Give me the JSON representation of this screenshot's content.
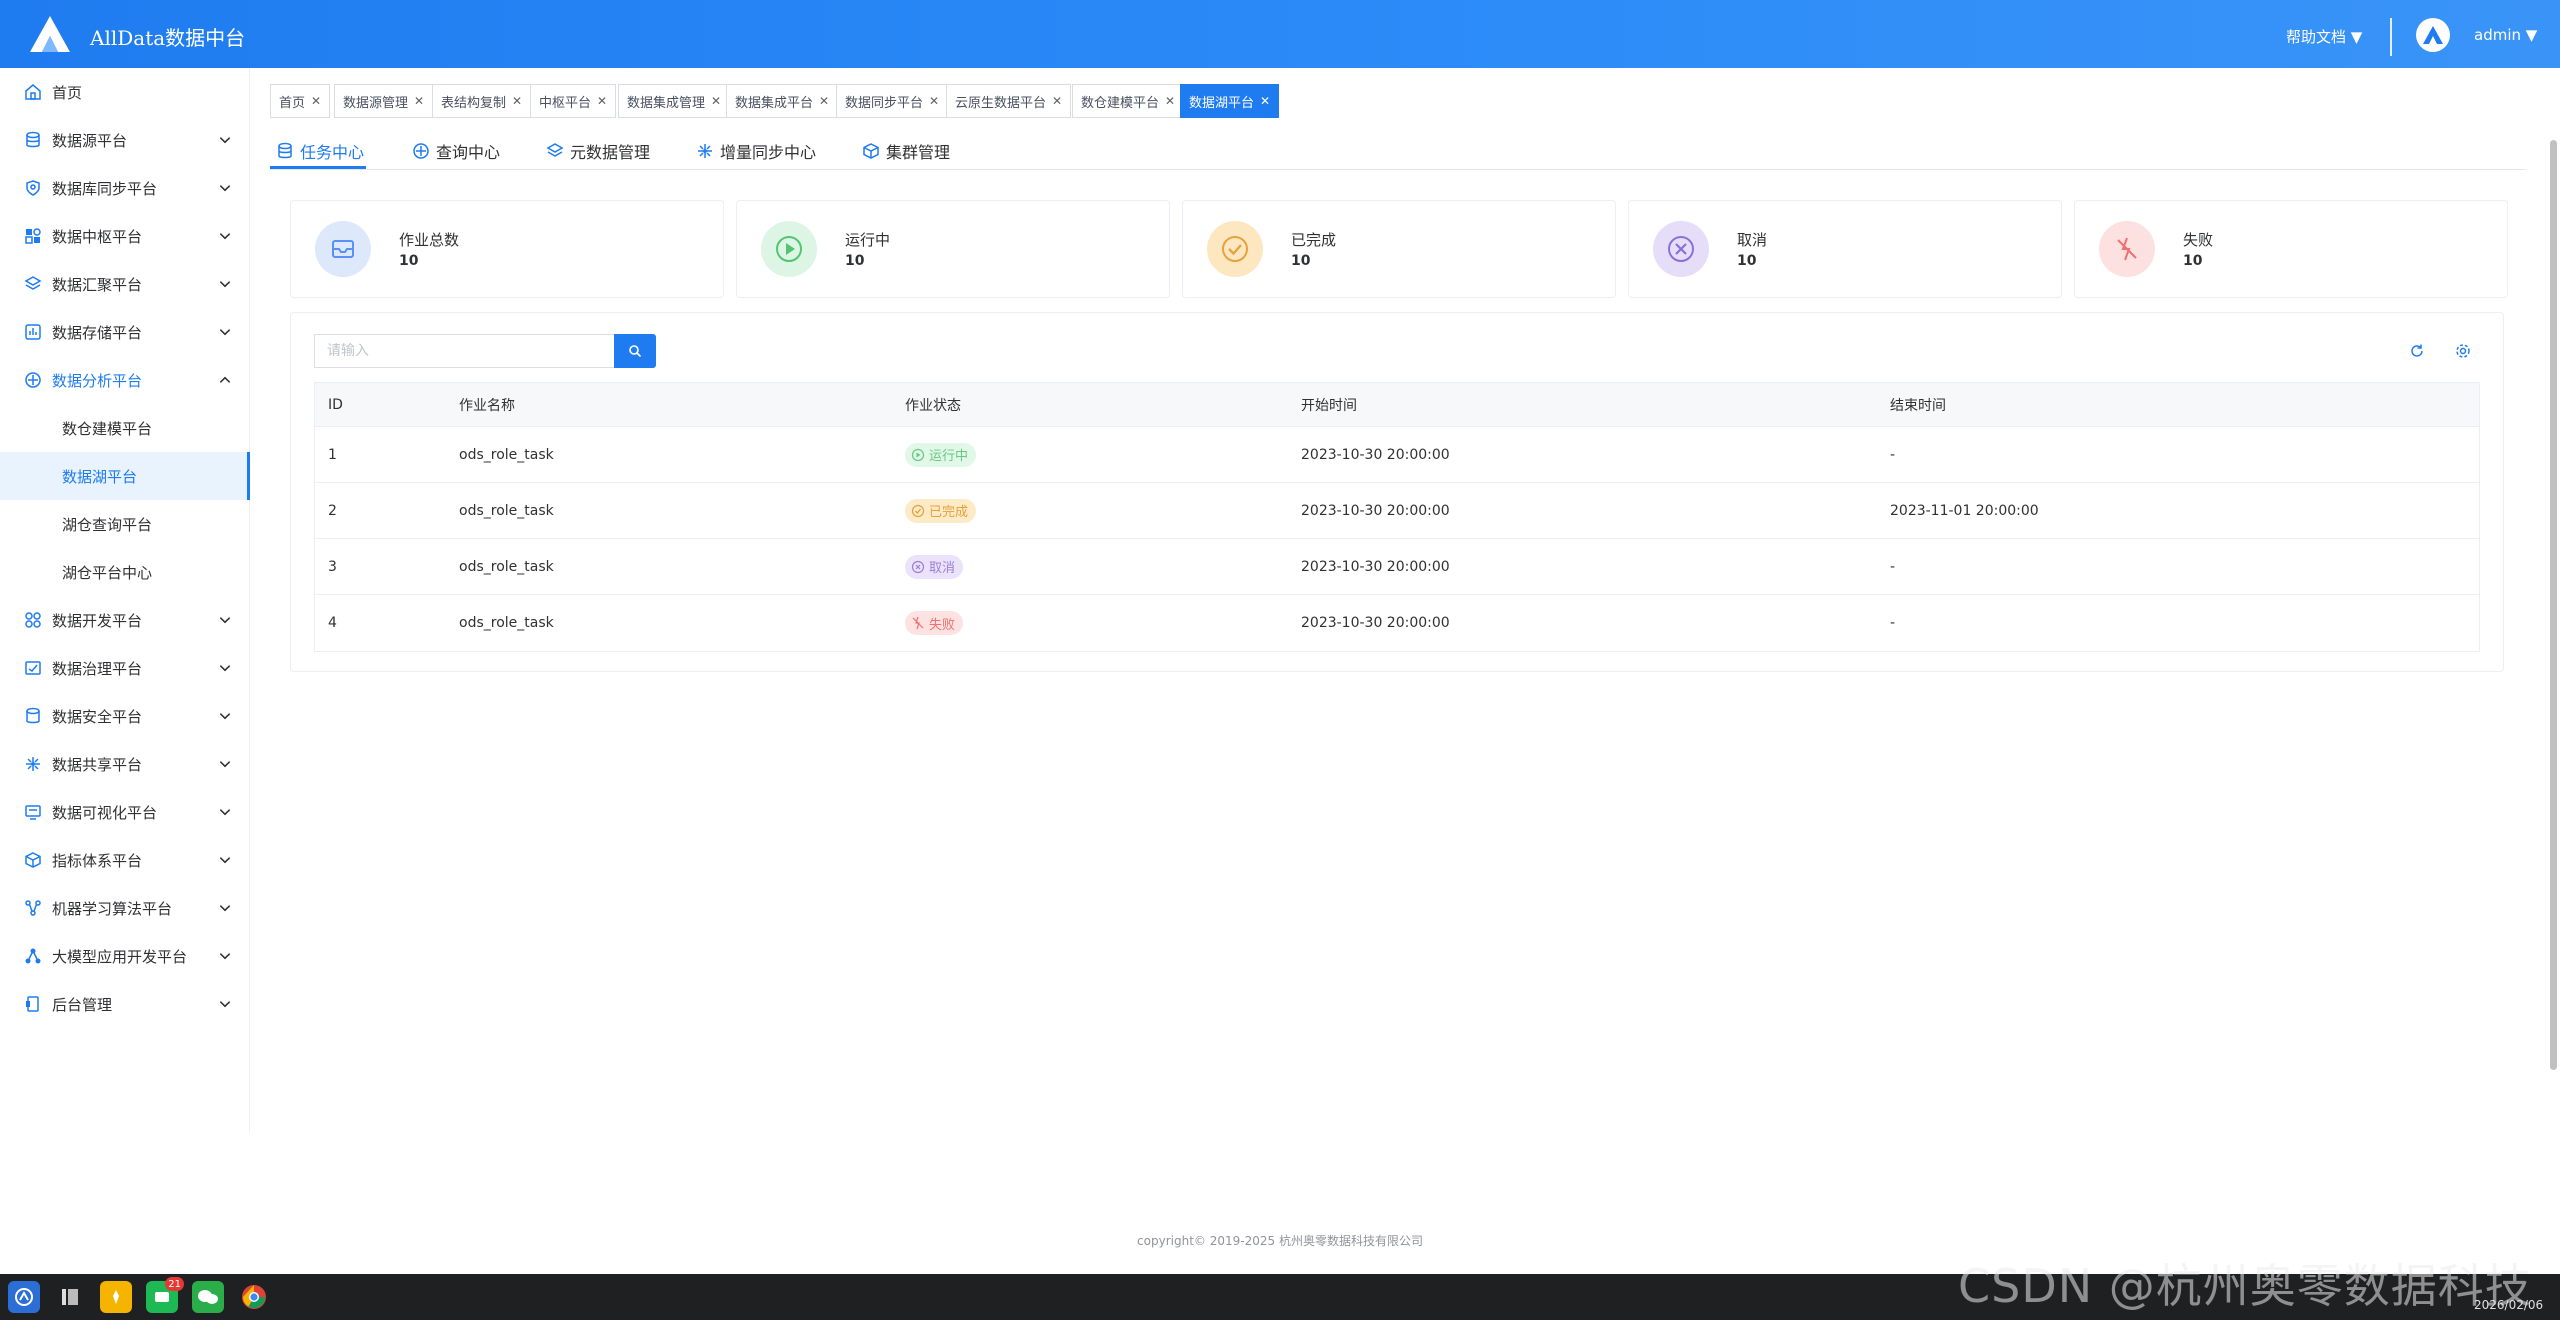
{
  "header": {
    "app_title": "AllData数据中台",
    "help_docs": "帮助文档 ▼",
    "username": "admin ▼"
  },
  "sidebar": {
    "items": [
      {
        "label": "首页",
        "icon": "home-icon",
        "has_arrow": false
      },
      {
        "label": "数据源平台",
        "icon": "database-icon",
        "has_arrow": true
      },
      {
        "label": "数据库同步平台",
        "icon": "shield-db-icon",
        "has_arrow": true
      },
      {
        "label": "数据中枢平台",
        "icon": "blocks-icon",
        "has_arrow": true
      },
      {
        "label": "数据汇聚平台",
        "icon": "layers-icon",
        "has_arrow": true
      },
      {
        "label": "数据存储平台",
        "icon": "bar-chart-icon",
        "has_arrow": true
      },
      {
        "label": "数据分析平台",
        "icon": "analysis-icon",
        "has_arrow": true,
        "expanded": true
      },
      {
        "label": "数据开发平台",
        "icon": "dev-icon",
        "has_arrow": true
      },
      {
        "label": "数据治理平台",
        "icon": "governance-icon",
        "has_arrow": true
      },
      {
        "label": "数据安全平台",
        "icon": "security-icon",
        "has_arrow": true
      },
      {
        "label": "数据共享平台",
        "icon": "share-icon",
        "has_arrow": true
      },
      {
        "label": "数据可视化平台",
        "icon": "monitor-icon",
        "has_arrow": true
      },
      {
        "label": "指标体系平台",
        "icon": "cube-icon",
        "has_arrow": true
      },
      {
        "label": "机器学习算法平台",
        "icon": "ml-icon",
        "has_arrow": true
      },
      {
        "label": "大模型应用开发平台",
        "icon": "llm-icon",
        "has_arrow": true
      },
      {
        "label": "后台管理",
        "icon": "admin-icon",
        "has_arrow": true
      }
    ],
    "sub_items": [
      {
        "label": "数仓建模平台",
        "active": false
      },
      {
        "label": "数据湖平台",
        "active": true
      },
      {
        "label": "湖仓查询平台",
        "active": false
      },
      {
        "label": "湖仓平台中心",
        "active": false
      }
    ]
  },
  "tags": [
    {
      "label": "首页"
    },
    {
      "label": "数据源管理"
    },
    {
      "label": "表结构复制"
    },
    {
      "label": "中枢平台"
    },
    {
      "label": "数据集成管理"
    },
    {
      "label": "数据集成平台"
    },
    {
      "label": "数据同步平台"
    },
    {
      "label": "云原生数据平台"
    },
    {
      "label": "数仓建模平台"
    },
    {
      "label": "数据湖平台",
      "active": true
    }
  ],
  "tabs": [
    {
      "label": "任务中心",
      "active": true
    },
    {
      "label": "查询中心"
    },
    {
      "label": "元数据管理"
    },
    {
      "label": "增量同步中心"
    },
    {
      "label": "集群管理"
    }
  ],
  "stats": [
    {
      "label": "作业总数",
      "value": "10",
      "color": "#5b8ff9",
      "bg": "#dde8fb"
    },
    {
      "label": "运行中",
      "value": "10",
      "color": "#52c472",
      "bg": "#dcf5e4"
    },
    {
      "label": "已完成",
      "value": "10",
      "color": "#e6a23c",
      "bg": "#fde7c0"
    },
    {
      "label": "取消",
      "value": "10",
      "color": "#8c6fd6",
      "bg": "#e6ddf8"
    },
    {
      "label": "失败",
      "value": "10",
      "color": "#f07070",
      "bg": "#fde0e0"
    }
  ],
  "search": {
    "placeholder": "请输入"
  },
  "table": {
    "columns": [
      "ID",
      "作业名称",
      "作业状态",
      "开始时间",
      "结束时间"
    ],
    "rows": [
      {
        "id": "1",
        "name": "ods_role_task",
        "status": "运行中",
        "status_type": "running",
        "start": "2023-10-30 20:00:00",
        "end": "-"
      },
      {
        "id": "2",
        "name": "ods_role_task",
        "status": "已完成",
        "status_type": "done",
        "start": "2023-10-30 20:00:00",
        "end": "2023-11-01 20:00:00"
      },
      {
        "id": "3",
        "name": "ods_role_task",
        "status": "取消",
        "status_type": "cancel",
        "start": "2023-10-30 20:00:00",
        "end": "-"
      },
      {
        "id": "4",
        "name": "ods_role_task",
        "status": "失败",
        "status_type": "fail",
        "start": "2023-10-30 20:00:00",
        "end": "-"
      }
    ]
  },
  "footer": {
    "copyright": "copyright© 2019-2025 杭州奥零数据科技有限公司"
  },
  "taskbar": {
    "apps": [
      "launcher-icon",
      "files-icon",
      "notes-icon",
      "chat-app-icon",
      "wechat-icon",
      "chrome-icon"
    ],
    "chat_badge": "21",
    "date": "2026/02/06"
  },
  "watermark": "CSDN @杭州奥零数据科技"
}
